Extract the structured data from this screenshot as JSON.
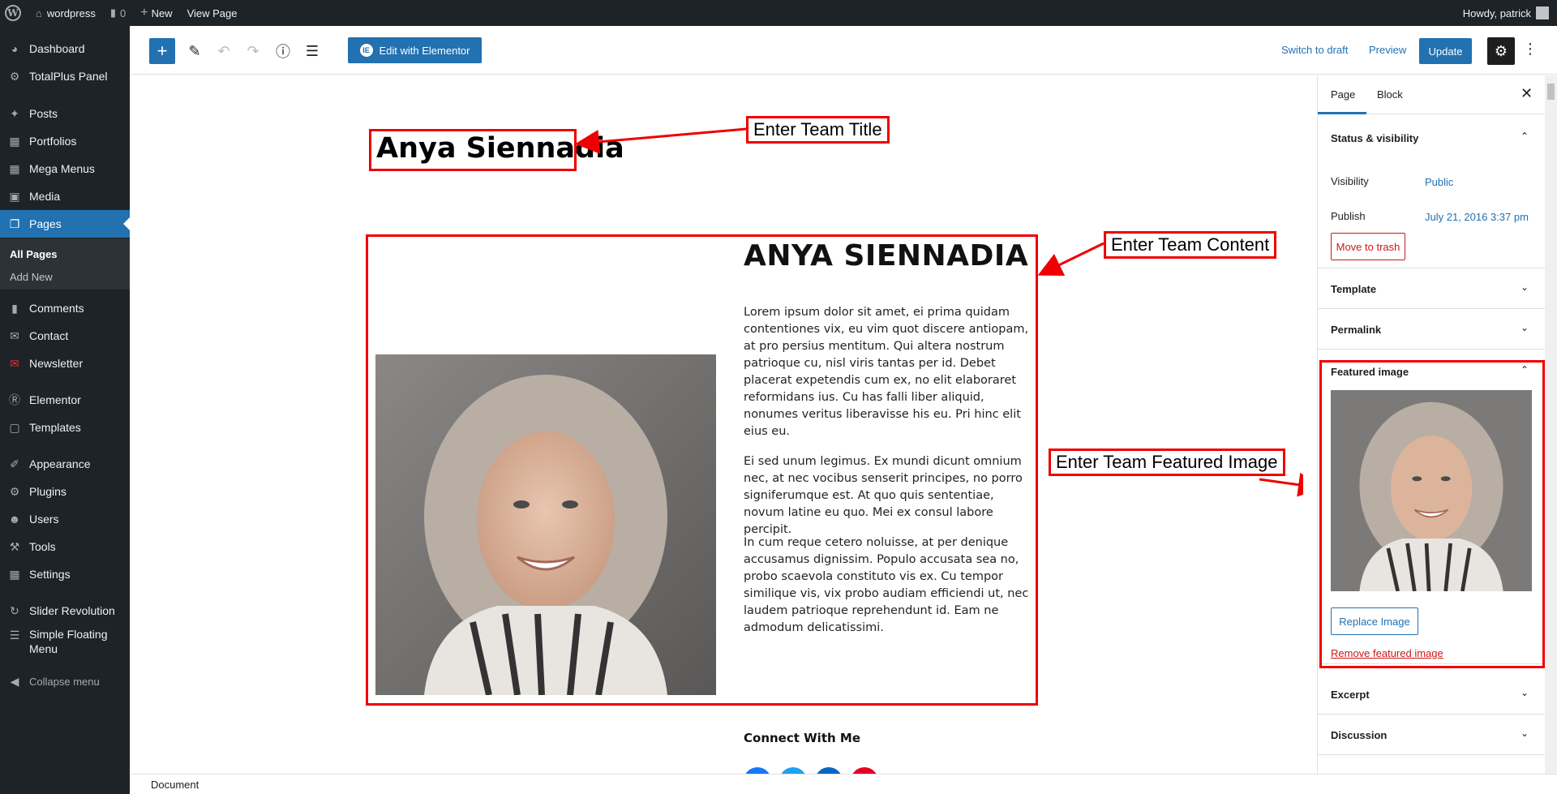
{
  "adminbar": {
    "site_name": "wordpress",
    "comments_count": "0",
    "new_label": "New",
    "view_page": "View Page",
    "howdy": "Howdy, patrick"
  },
  "menu": {
    "items": [
      {
        "label": "Dashboard",
        "icon": "dashboard-icon"
      },
      {
        "label": "TotalPlus Panel",
        "icon": "gear-icon"
      },
      {
        "label": "Posts",
        "icon": "pin-icon"
      },
      {
        "label": "Portfolios",
        "icon": "grid-icon"
      },
      {
        "label": "Mega Menus",
        "icon": "grid-icon"
      },
      {
        "label": "Media",
        "icon": "media-icon"
      },
      {
        "label": "Pages",
        "icon": "pages-icon"
      },
      {
        "label": "Comments",
        "icon": "comment-icon"
      },
      {
        "label": "Contact",
        "icon": "mail-icon"
      },
      {
        "label": "Newsletter",
        "icon": "newsletter-icon"
      },
      {
        "label": "Elementor",
        "icon": "elementor-icon"
      },
      {
        "label": "Templates",
        "icon": "folder-icon"
      },
      {
        "label": "Appearance",
        "icon": "brush-icon"
      },
      {
        "label": "Plugins",
        "icon": "plugin-icon"
      },
      {
        "label": "Users",
        "icon": "user-icon"
      },
      {
        "label": "Tools",
        "icon": "wrench-icon"
      },
      {
        "label": "Settings",
        "icon": "settings-icon"
      },
      {
        "label": "Slider Revolution",
        "icon": "refresh-icon"
      },
      {
        "label": "Simple Floating Menu",
        "icon": "menu-icon"
      }
    ],
    "submenu_all_pages": "All Pages",
    "submenu_add_new": "Add New",
    "collapse": "Collapse menu"
  },
  "header": {
    "edit_with_elementor": "Edit with Elementor",
    "switch_to_draft": "Switch to draft",
    "preview": "Preview",
    "update": "Update"
  },
  "content": {
    "post_title": "Anya Siennadia",
    "heading": "ANYA SIENNADIA",
    "paragraphs": [
      "Lorem ipsum dolor sit amet, ei prima quidam contentiones vix, eu vim quot discere antiopam, at pro persius mentitum. Qui altera nostrum patrioque cu, nisl viris tantas per id. Debet placerat expetendis cum ex, no elit elaboraret reformidans ius. Cu has falli liber aliquid, nonumes veritus liberavisse his eu. Pri hinc elit eius eu.",
      "Ei sed unum legimus. Ex mundi dicunt omnium nec, at nec vocibus senserit principes, no porro signiferumque est. At quo quis sententiae, novum latine eu quo. Mei ex consul labore percipit.",
      "In cum reque cetero noluisse, at per denique accusamus dignissim. Populo accusata sea no, probo scaevola constituto vis ex. Cu tempor similique vis, vix probo audiam efficiendi ut, nec laudem patrioque reprehendunt id. Eam ne admodum delicatissimi."
    ],
    "connect": "Connect With Me"
  },
  "annotations": {
    "title": "Enter Team Title",
    "content": "Enter Team Content",
    "featured": "Enter Team Featured Image"
  },
  "sidebar": {
    "tab_page": "Page",
    "tab_block": "Block",
    "status_visibility": "Status & visibility",
    "visibility_label": "Visibility",
    "visibility_value": "Public",
    "publish_label": "Publish",
    "publish_value": "July 21, 2016 3:37 pm",
    "move_to_trash": "Move to trash",
    "template": "Template",
    "permalink": "Permalink",
    "featured_image": "Featured image",
    "replace_image": "Replace Image",
    "remove_featured": "Remove featured image",
    "excerpt": "Excerpt",
    "discussion": "Discussion"
  },
  "footer": {
    "breadcrumb": "Document"
  },
  "colors": {
    "admin_dark": "#1d2327",
    "accent": "#2271b1",
    "annotation": "#e00000",
    "danger": "#cc1818"
  }
}
